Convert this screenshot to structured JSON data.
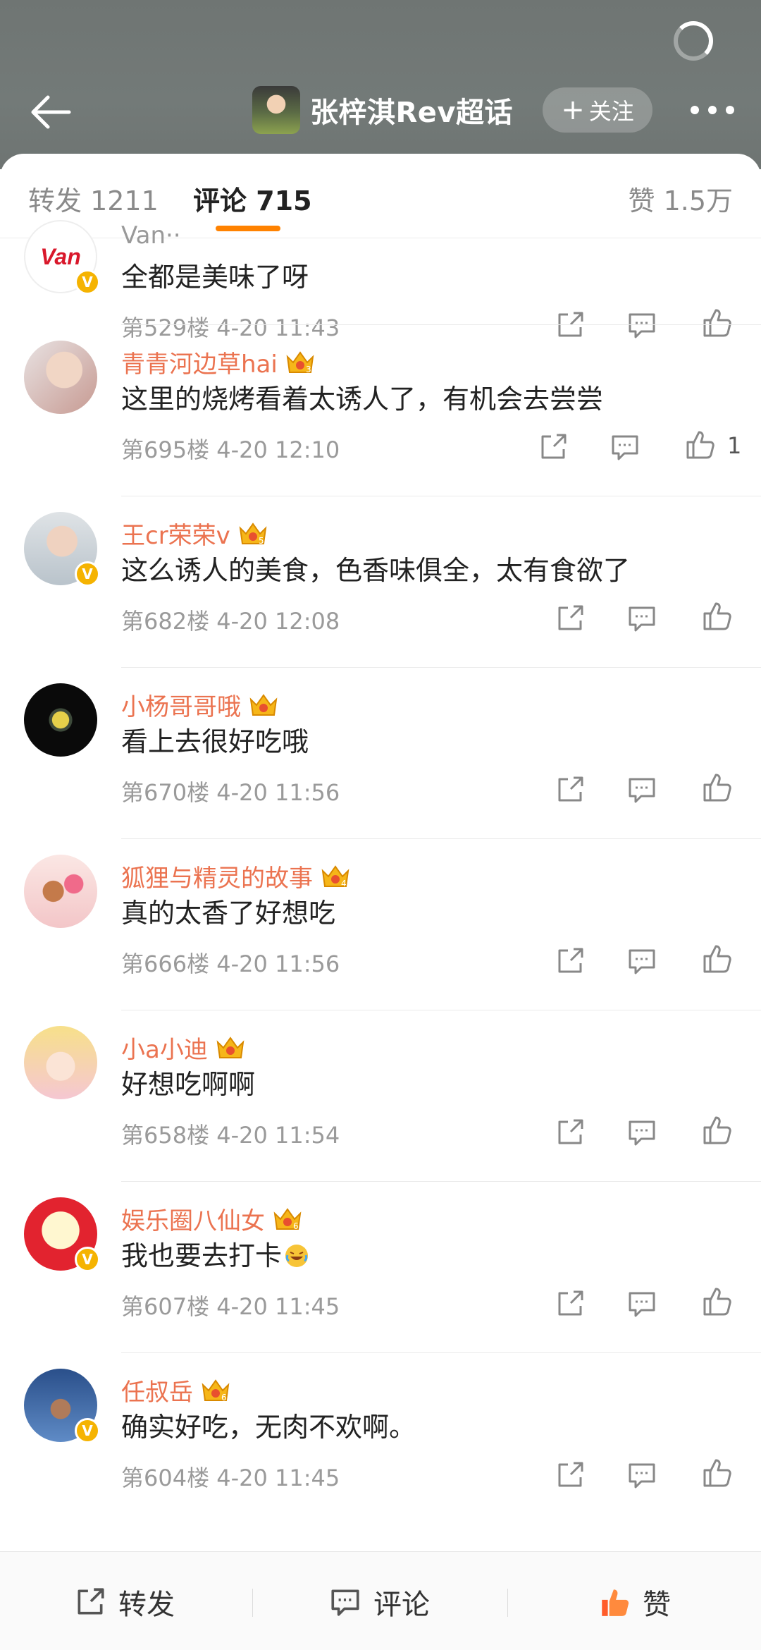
{
  "header": {
    "title": "张梓淇Rev超话",
    "follow_label": "关注"
  },
  "tabs": {
    "repost": "转发 1211",
    "comment": "评论 715",
    "like": "赞 1.5万"
  },
  "comments": [
    {
      "user": "Van··",
      "text": "全都是美味了呀",
      "meta": "第529楼 4-20 11:43",
      "likes": ""
    },
    {
      "user": "青青河边草hai",
      "level": "3",
      "text": "这里的烧烤看着太诱人了，有机会去尝尝",
      "meta": "第695楼 4-20 12:10",
      "likes": "1"
    },
    {
      "user": "王cr荣荣v",
      "level": "5",
      "text": "这么诱人的美食，色香味俱全，太有食欲了",
      "meta": "第682楼 4-20 12:08",
      "likes": ""
    },
    {
      "user": "小杨哥哥哦",
      "level": "",
      "text": "看上去很好吃哦",
      "meta": "第670楼 4-20 11:56",
      "likes": ""
    },
    {
      "user": "狐狸与精灵的故事",
      "level": "4",
      "text": "真的太香了好想吃",
      "meta": "第666楼 4-20 11:56",
      "likes": ""
    },
    {
      "user": "小a小迪",
      "level": "",
      "text": "好想吃啊啊",
      "meta": "第658楼 4-20 11:54",
      "likes": ""
    },
    {
      "user": "娱乐圈八仙女",
      "level": "6",
      "text": "我也要去打卡",
      "meta": "第607楼 4-20 11:45",
      "likes": ""
    },
    {
      "user": "任叔岳",
      "level": "6",
      "text": "确实好吃，无肉不欢啊。",
      "meta": "第604楼 4-20 11:45",
      "likes": ""
    }
  ],
  "bottom_bar": {
    "repost": "转发",
    "comment": "评论",
    "like": "赞"
  },
  "colors": {
    "accent": "#ff8200",
    "username": "#eb7350",
    "verified": "#f5b301"
  },
  "icons": [
    "back-arrow-icon",
    "loading-spinner-icon",
    "more-dots-icon",
    "share-icon",
    "comment-icon",
    "thumb-up-icon",
    "crown-icon",
    "verified-badge-icon"
  ]
}
